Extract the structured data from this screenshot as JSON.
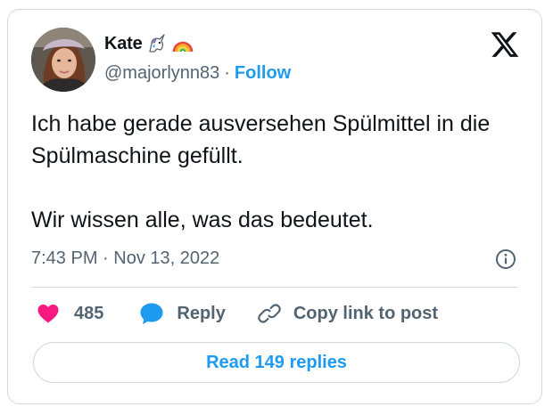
{
  "author": {
    "display_name": "Kate",
    "emoji_icons": [
      "unicorn-icon",
      "rainbow-icon"
    ],
    "handle": "@majorlynn83",
    "separator": "·",
    "follow_label": "Follow"
  },
  "tweet": {
    "paragraphs": [
      "Ich habe gerade ausversehen Spülmittel in die Spülmaschine gefüllt.",
      "Wir wissen alle, was das bedeutet."
    ],
    "timestamp": "7:43 PM · Nov 13, 2022"
  },
  "actions": {
    "like_count": "485",
    "reply_label": "Reply",
    "copy_link_label": "Copy link to post"
  },
  "read_replies_label": "Read 149 replies",
  "colors": {
    "accent": "#1d9bf0",
    "like": "#f91880",
    "text": "#0f1419",
    "muted": "#536471",
    "border": "#cfd9de"
  }
}
